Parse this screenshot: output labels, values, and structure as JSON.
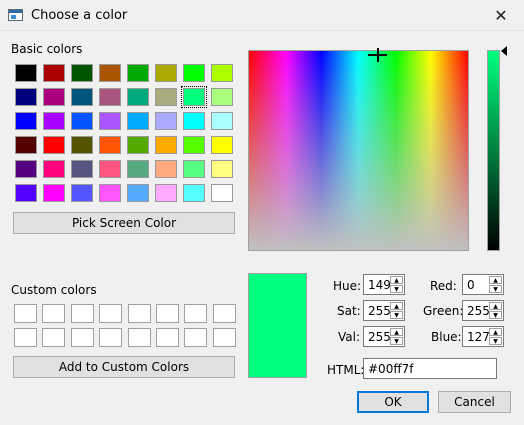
{
  "window": {
    "title": "Choose a color",
    "close_glyph": "✕"
  },
  "basic_colors": {
    "label": "Basic colors",
    "colors": [
      "#000000",
      "#aa0000",
      "#005500",
      "#aa5500",
      "#00aa00",
      "#aaaa00",
      "#00ff00",
      "#aaff00",
      "#00007f",
      "#aa007f",
      "#00557f",
      "#aa557f",
      "#00aa7f",
      "#aaaa7f",
      "#00ff7f",
      "#aaff7f",
      "#0000ff",
      "#aa00ff",
      "#0055ff",
      "#aa55ff",
      "#00aaff",
      "#aaaaff",
      "#00ffff",
      "#aaffff",
      "#550000",
      "#ff0000",
      "#555500",
      "#ff5500",
      "#55aa00",
      "#ffaa00",
      "#55ff00",
      "#ffff00",
      "#55007f",
      "#ff007f",
      "#55557f",
      "#ff557f",
      "#55aa7f",
      "#ffaa7f",
      "#55ff7f",
      "#ffff7f",
      "#5500ff",
      "#ff00ff",
      "#5555ff",
      "#ff55ff",
      "#55aaff",
      "#ffaaff",
      "#55ffff",
      "#ffffff"
    ],
    "selected_index": 14
  },
  "pick_screen_button": "Pick Screen Color",
  "custom_colors": {
    "label": "Custom colors",
    "colors": [
      "#ffffff",
      "#ffffff",
      "#ffffff",
      "#ffffff",
      "#ffffff",
      "#ffffff",
      "#ffffff",
      "#ffffff",
      "#ffffff",
      "#ffffff",
      "#ffffff",
      "#ffffff",
      "#ffffff",
      "#ffffff",
      "#ffffff",
      "#ffffff"
    ]
  },
  "add_custom_button": "Add to Custom Colors",
  "current_color": "#00ff7f",
  "fields": {
    "hue": {
      "label": "Hue:",
      "value": "149"
    },
    "sat": {
      "label": "Sat:",
      "value": "255"
    },
    "val": {
      "label": "Val:",
      "value": "255"
    },
    "red": {
      "label": "Red:",
      "value": "0"
    },
    "green": {
      "label": "Green:",
      "value": "255"
    },
    "blue": {
      "label": "Blue:",
      "value": "127"
    },
    "html": {
      "label": "HTML:",
      "value": "#00ff7f"
    }
  },
  "buttons": {
    "ok": "OK",
    "cancel": "Cancel"
  },
  "icons": {
    "up": "▲",
    "down": "▼"
  }
}
